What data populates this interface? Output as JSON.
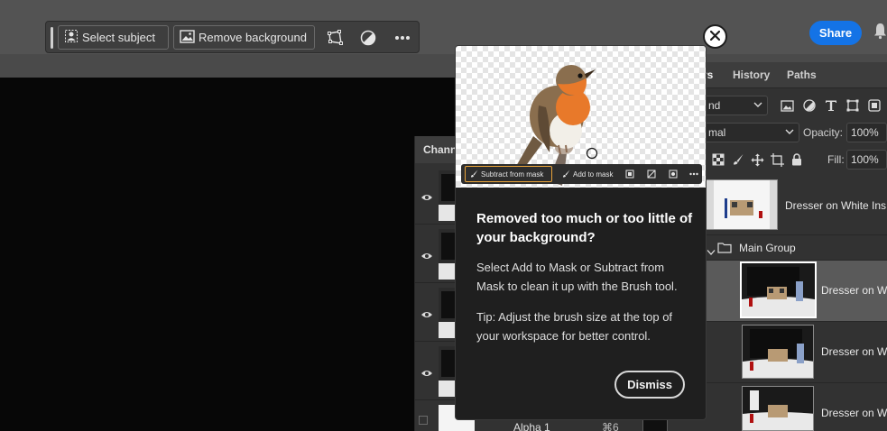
{
  "taskbar": {
    "select_subject": "Select subject",
    "remove_background": "Remove background",
    "icons": [
      "person-select-icon",
      "image-icon",
      "transform-icon",
      "contrast-icon",
      "more-icon"
    ]
  },
  "share_label": "Share",
  "layers_panel": {
    "tabs": [
      {
        "label": "rs",
        "active": true
      },
      {
        "label": "History"
      },
      {
        "label": "Paths"
      }
    ],
    "filter_kind": "nd",
    "blend_mode": "mal",
    "opacity_label": "Opacity:",
    "opacity_value": "100%",
    "fill_label": "Fill:",
    "fill_value": "100%",
    "layers": [
      {
        "name": "Dresser on White Ins"
      },
      {
        "name": "Main Group"
      },
      {
        "name": "Dresser on W"
      },
      {
        "name": "Dresser on W"
      },
      {
        "name": "Dresser on W"
      }
    ]
  },
  "channels_panel": {
    "title": "Chann",
    "alpha_label": "Alpha 1",
    "alpha_shortcut": "⌘6"
  },
  "popup": {
    "toolbar": {
      "subtract_label": "Subtract from mask",
      "add_label": "Add to mask"
    },
    "title": "Removed too much or too little of your background?",
    "body1": "Select Add to Mask or Subtract from Mask to clean it up with the Brush tool.",
    "body2": "Tip: Adjust the brush size at the top of your workspace for better control.",
    "dismiss_label": "Dismiss"
  },
  "colors": {
    "accent": "#1473e6",
    "highlight_border": "#e8a33a",
    "robin_breast": "#e8792a"
  }
}
